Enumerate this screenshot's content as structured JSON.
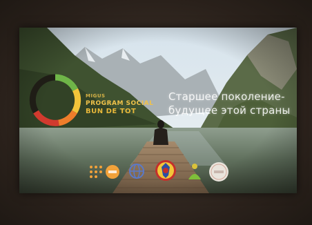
{
  "presentation": {
    "brand": {
      "line1": "MIGUS",
      "line2": "PROGRAM SOCIAL",
      "line3": "BUN DE TOT"
    },
    "slogan": {
      "line1": "Старшее поколение-",
      "line2": "будущее этой страны"
    },
    "logos": [
      {
        "icon": "dots-grid-icon"
      },
      {
        "icon": "unfpa-logo"
      },
      {
        "icon": "world-globe-logo"
      },
      {
        "icon": "moldova-coat-of-arms-logo"
      },
      {
        "icon": "green-figure-logo"
      },
      {
        "icon": "round-white-seal-logo"
      }
    ],
    "colors": {
      "brand_gold": "#f0c24a",
      "ring_green": "#6fb548",
      "ring_yellow": "#f2c43a",
      "ring_orange": "#ef7d2b",
      "ring_red": "#d13a2e",
      "ring_purple": "#6a3a8c"
    }
  }
}
